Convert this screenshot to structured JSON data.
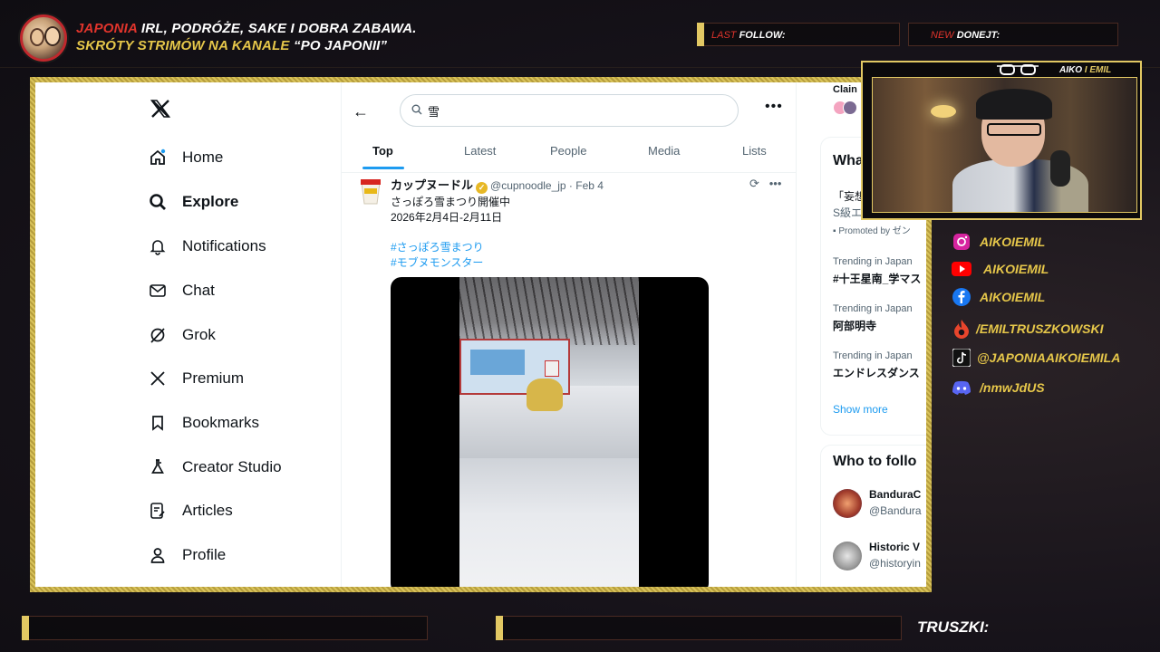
{
  "overlay": {
    "headline_red": "JAPONIA",
    "headline_white": " IRL, PODRÓŻE, SAKE I DOBRA ZABAWA.",
    "sub_gold_1": "SKRÓTY STRIMÓW NA KANALE ",
    "sub_white_2": "“PO JAPONII”",
    "last_follow_red": "LAST ",
    "last_follow_white": "FOLLOW:",
    "new_donate_red": "NEW ",
    "new_donate_white": "DONEJT:",
    "cam_label_white": "AIKO ",
    "cam_label_gold": "I ",
    "cam_label_white2": "EMIL",
    "truszki": "TRUSZKI:",
    "socials": [
      {
        "icon": "instagram-icon",
        "color": "#d6249f",
        "text": "AIKOIEMIL"
      },
      {
        "icon": "youtube-icon",
        "color": "#ff0000",
        "text": "AIKOIEMIL"
      },
      {
        "icon": "facebook-icon",
        "color": "#1877f2",
        "text": "AIKOIEMIL"
      },
      {
        "icon": "patronite-icon",
        "color": "#e8452c",
        "text": "/EMILTRUSZKOWSKI"
      },
      {
        "icon": "tiktok-icon",
        "color": "#ffffff",
        "text": "@JAPONIAAIKOIEMILA"
      },
      {
        "icon": "discord-icon",
        "color": "#5865f2",
        "text": "/nmwJdUS"
      }
    ]
  },
  "nav": {
    "items": [
      {
        "label": "Home",
        "icon": "home-icon"
      },
      {
        "label": "Explore",
        "icon": "search-icon"
      },
      {
        "label": "Notifications",
        "icon": "bell-icon"
      },
      {
        "label": "Chat",
        "icon": "mail-icon"
      },
      {
        "label": "Grok",
        "icon": "grok-icon"
      },
      {
        "label": "Premium",
        "icon": "x-icon"
      },
      {
        "label": "Bookmarks",
        "icon": "bookmark-icon"
      },
      {
        "label": "Creator Studio",
        "icon": "flask-icon"
      },
      {
        "label": "Articles",
        "icon": "articles-icon"
      },
      {
        "label": "Profile",
        "icon": "person-icon"
      }
    ]
  },
  "search": {
    "value": "雪",
    "more": "•••"
  },
  "tabs": [
    "Top",
    "Latest",
    "People",
    "Media",
    "Lists"
  ],
  "tweet": {
    "name": "カップヌードル",
    "handle": "@cupnoodle_jp · Feb 4",
    "line1": "さっぽろ雪まつり開催中",
    "line2": "2026年2月4日-2月11日",
    "tag1": "#さっぽろ雪まつり",
    "tag2": "#モブヌモンスター"
  },
  "right": {
    "top_cut": "Clain",
    "whats_title": "What",
    "promo_text": "「妄想",
    "promo_sub": "S級エ",
    "promoted": "Promoted by ゼン",
    "trends": [
      {
        "meta": "Trending in Japan",
        "name": "#十王星南_学マス"
      },
      {
        "meta": "Trending in Japan",
        "name": "阿部明寺"
      },
      {
        "meta": "Trending in Japan",
        "name": "エンドレスダンス"
      }
    ],
    "show_more": "Show more",
    "who_title": "Who to follo",
    "follow": [
      {
        "name": "BanduraC",
        "handle": "@Bandura"
      },
      {
        "name": "Historic V",
        "handle": "@historyin"
      }
    ]
  },
  "colors": {
    "accent": "#1d9bf0",
    "gold": "#e2c863",
    "red": "#e0342c"
  }
}
